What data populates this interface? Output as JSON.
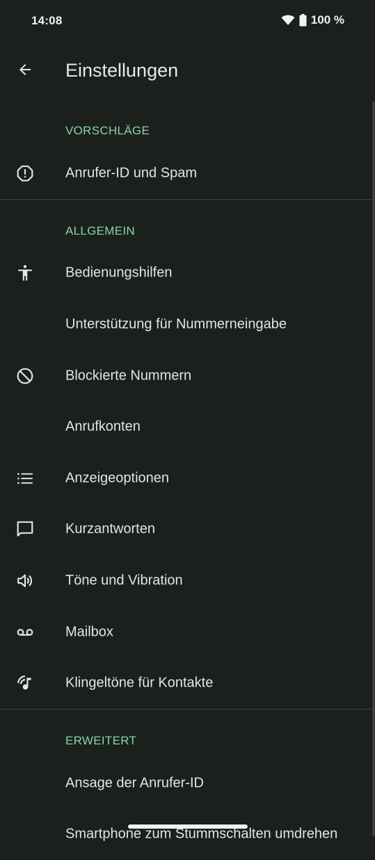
{
  "status_bar": {
    "time": "14:08",
    "battery_text": "100 %",
    "icons": [
      "wifi-icon",
      "battery-icon"
    ]
  },
  "app_bar": {
    "title": "Einstellungen",
    "back_icon": "arrow-back-icon"
  },
  "sections": {
    "suggestions": {
      "header": "VORSCHLÄGE",
      "items": {
        "caller_id": {
          "label": "Anrufer-ID und Spam",
          "icon": "alert-octagon-icon"
        }
      }
    },
    "general": {
      "header": "ALLGEMEIN",
      "items": {
        "accessibility": {
          "label": "Bedienungshilfen",
          "icon": "accessibility-icon"
        },
        "dial_assist": {
          "label": "Unterstützung für Nummerneingabe"
        },
        "blocked": {
          "label": "Blockierte Nummern",
          "icon": "block-icon"
        },
        "accounts": {
          "label": "Anrufkonten"
        },
        "display": {
          "label": "Anzeigeoptionen",
          "icon": "list-icon"
        },
        "quick_responses": {
          "label": "Kurzantworten",
          "icon": "message-icon"
        },
        "sounds": {
          "label": "Töne und Vibration",
          "icon": "volume-icon"
        },
        "voicemail": {
          "label": "Mailbox",
          "icon": "voicemail-icon"
        },
        "ringtones": {
          "label": "Klingeltöne für Kontakte",
          "icon": "contact-ringtone-icon"
        }
      }
    },
    "advanced": {
      "header": "ERWEITERT",
      "items": {
        "caller_id_announce": {
          "label": "Ansage der Anrufer-ID"
        },
        "flip_to_silence": {
          "label": "Smartphone zum Stummschalten umdrehen"
        }
      }
    }
  },
  "colors": {
    "background": "#1b201d",
    "accent": "#87d5a6",
    "text": "#e3e6e2",
    "divider": "#3d433f"
  }
}
